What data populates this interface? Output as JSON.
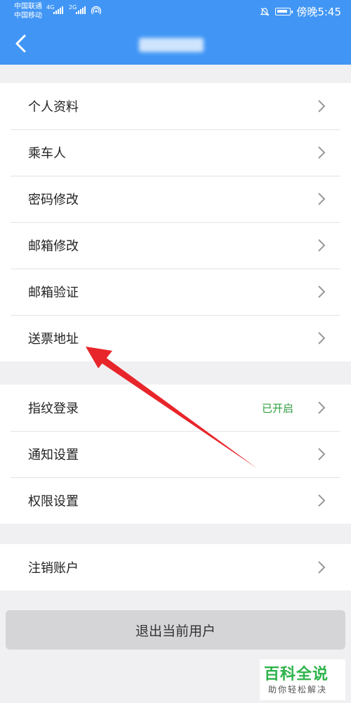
{
  "status_bar": {
    "carrier_1": "中国联通",
    "carrier_2": "中国移动",
    "net_1": "4G",
    "net_2": "2G",
    "time": "傍晚5:45"
  },
  "header": {
    "title": ""
  },
  "groups": [
    {
      "items": [
        {
          "label": "个人资料"
        },
        {
          "label": "乘车人"
        },
        {
          "label": "密码修改"
        },
        {
          "label": "邮箱修改"
        },
        {
          "label": "邮箱验证"
        },
        {
          "label": "送票地址"
        }
      ]
    },
    {
      "items": [
        {
          "label": "指纹登录",
          "status": "已开启"
        },
        {
          "label": "通知设置"
        },
        {
          "label": "权限设置"
        }
      ]
    },
    {
      "items": [
        {
          "label": "注销账户"
        }
      ]
    }
  ],
  "logout_label": "退出当前用户",
  "annotation": {
    "color": "#e8252a"
  },
  "watermark": {
    "title": "百科全说",
    "subtitle": "助你轻松解决"
  },
  "colors": {
    "header": "#4196f5",
    "status_enabled": "#2f9e3f"
  }
}
